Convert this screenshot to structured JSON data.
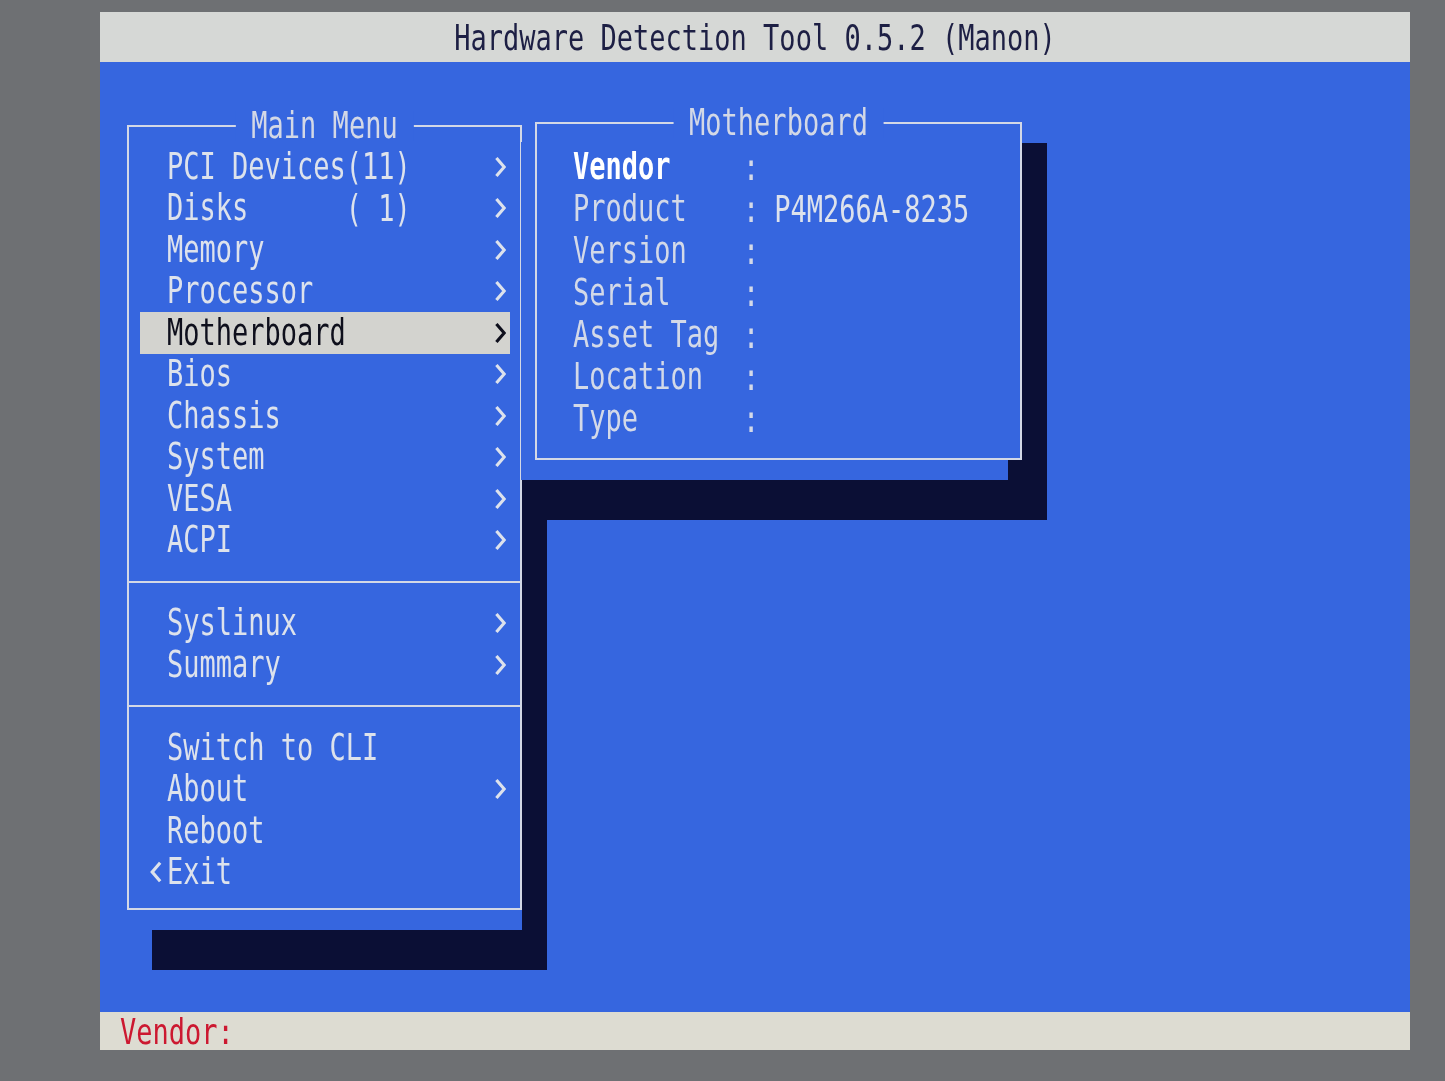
{
  "window": {
    "title": "Hardware Detection Tool 0.5.2 (Manon)"
  },
  "main_menu": {
    "title": "Main Menu",
    "sections": [
      {
        "items": [
          {
            "label": "PCI Devices",
            "count": "(11)",
            "kind": "submenu",
            "selected": false
          },
          {
            "label": "Disks",
            "count": "( 1)",
            "kind": "submenu",
            "selected": false
          },
          {
            "label": "Memory",
            "kind": "submenu",
            "selected": false
          },
          {
            "label": "Processor",
            "kind": "submenu",
            "selected": false
          },
          {
            "label": "Motherboard",
            "kind": "submenu",
            "selected": true
          },
          {
            "label": "Bios",
            "kind": "submenu",
            "selected": false
          },
          {
            "label": "Chassis",
            "kind": "submenu",
            "selected": false
          },
          {
            "label": "System",
            "kind": "submenu",
            "selected": false
          },
          {
            "label": "VESA",
            "kind": "submenu",
            "selected": false
          },
          {
            "label": "ACPI",
            "kind": "submenu",
            "selected": false
          }
        ]
      },
      {
        "items": [
          {
            "label": "Syslinux",
            "kind": "submenu",
            "selected": false
          },
          {
            "label": "Summary",
            "kind": "submenu",
            "selected": false
          }
        ]
      },
      {
        "items": [
          {
            "label": "Switch to CLI",
            "kind": "action",
            "selected": false
          },
          {
            "label": "About",
            "kind": "submenu",
            "selected": false
          },
          {
            "label": "Reboot",
            "kind": "action",
            "selected": false
          },
          {
            "label": "Exit",
            "kind": "back",
            "selected": false
          }
        ]
      }
    ]
  },
  "detail_panel": {
    "title": "Motherboard",
    "fields": [
      {
        "label": "Vendor",
        "separator": ":",
        "selected": true
      },
      {
        "label": "Product",
        "separator": ":",
        "value": "P4M266A-8235",
        "selected": false
      },
      {
        "label": "Version",
        "separator": ":",
        "selected": false
      },
      {
        "label": "Serial",
        "separator": ":",
        "selected": false
      },
      {
        "label": "Asset Tag",
        "separator": ":",
        "selected": false
      },
      {
        "label": "Location",
        "separator": ":",
        "selected": false
      },
      {
        "label": "Type",
        "separator": ":",
        "selected": false
      }
    ]
  },
  "status_bar": {
    "text": "Vendor:"
  }
}
